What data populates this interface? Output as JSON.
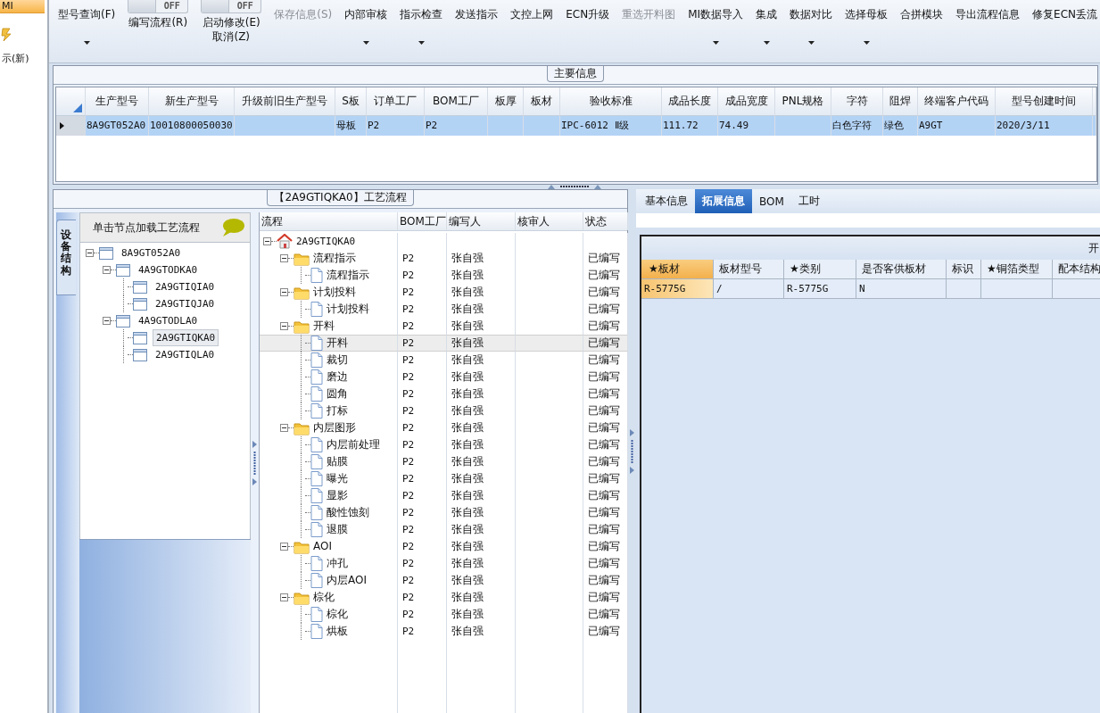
{
  "sidebar": {
    "items": [
      {
        "label": "MI",
        "kind": "text",
        "selected": true
      },
      {
        "kind": "icon",
        "selected": false
      },
      {
        "label": "示(新)",
        "kind": "text",
        "selected": false
      }
    ]
  },
  "ribbon": {
    "buttons": [
      {
        "kind": "button",
        "label": "型号查询(F)",
        "dropdown": true,
        "disabled": false
      },
      {
        "kind": "toggle",
        "toggle_text": "OFF",
        "on": false,
        "label": "编写流程(R)"
      },
      {
        "kind": "toggle",
        "toggle_text": "OFF",
        "on": false,
        "label": "启动修改(E)",
        "sublabel": "取消(Z)"
      },
      {
        "kind": "button",
        "label": "保存信息(S)",
        "dropdown": false,
        "disabled": true
      },
      {
        "kind": "button",
        "label": "内部审核",
        "dropdown": true,
        "disabled": false
      },
      {
        "kind": "button",
        "label": "指示检查",
        "dropdown": true,
        "disabled": false
      },
      {
        "kind": "button",
        "label": "发送指示",
        "dropdown": false,
        "disabled": false
      },
      {
        "kind": "button",
        "label": "文控上网",
        "dropdown": false,
        "disabled": false
      },
      {
        "kind": "button",
        "label": "ECN升级",
        "dropdown": false,
        "disabled": false
      },
      {
        "kind": "button",
        "label": "重选开料图",
        "dropdown": false,
        "disabled": true
      },
      {
        "kind": "button",
        "label": "MI数据导入",
        "dropdown": true,
        "disabled": false
      },
      {
        "kind": "button",
        "label": "集成",
        "dropdown": true,
        "disabled": false
      },
      {
        "kind": "button",
        "label": "数据对比",
        "dropdown": true,
        "disabled": false
      },
      {
        "kind": "button",
        "label": "选择母板",
        "dropdown": true,
        "disabled": false
      },
      {
        "kind": "button",
        "label": "合拼模块",
        "dropdown": false,
        "disabled": false
      },
      {
        "kind": "button",
        "label": "导出流程信息",
        "dropdown": false,
        "disabled": false
      },
      {
        "kind": "button",
        "label": "修复ECN丢流",
        "dropdown": false,
        "disabled": false
      }
    ]
  },
  "main_info": {
    "title": "主要信息",
    "table": {
      "columns": [
        "生产型号",
        "新生产型号",
        "升级前旧生产型号",
        "S板",
        "订单工厂",
        "BOM工厂",
        "板厚",
        "板材",
        "验收标准",
        "成品长度",
        "成品宽度",
        "PNL规格",
        "字符",
        "阻焊",
        "终端客户代码",
        "型号创建时间"
      ],
      "rows": [
        {
          "selected": true,
          "cells": [
            "8A9GT052A0",
            "10010800050030",
            "",
            "母板",
            "P2",
            "P2",
            "",
            "",
            "IPC-6012 Ⅱ级",
            "111.72",
            "74.49",
            "",
            "白色字符",
            "绿色",
            "A9GT",
            "2020/3/11"
          ]
        }
      ]
    }
  },
  "process_panel": {
    "title": "【2A9GTIQKA0】工艺流程",
    "side_tab": "设备结构",
    "tree_header": "单击节点加载工艺流程",
    "tree": [
      {
        "label": "8A9GT052A0",
        "expanded": true,
        "selected": false,
        "children": [
          {
            "label": "4A9GTODKA0",
            "expanded": true,
            "selected": false,
            "children": [
              {
                "label": "2A9GTIQIA0",
                "selected": false
              },
              {
                "label": "2A9GTIQJA0",
                "selected": false
              }
            ]
          },
          {
            "label": "4A9GTODLA0",
            "expanded": true,
            "selected": false,
            "children": [
              {
                "label": "2A9GTIQKA0",
                "selected": true
              },
              {
                "label": "2A9GTIQLA0",
                "selected": false
              }
            ]
          }
        ]
      }
    ],
    "grid": {
      "columns": [
        "流程",
        "BOM工厂",
        "编写人",
        "核审人",
        "状态"
      ],
      "rows": [
        {
          "kind": "root",
          "label": "2A9GTIQKA0",
          "expanded": true,
          "selected": false,
          "children": [
            {
              "kind": "folder",
              "label": "流程指示",
              "bom": "P2",
              "writer": "张自强",
              "status": "已编写",
              "expanded": true,
              "selected": false,
              "children": [
                {
                  "kind": "step",
                  "label": "流程指示",
                  "bom": "P2",
                  "writer": "张自强",
                  "status": "已编写",
                  "selected": false
                }
              ]
            },
            {
              "kind": "folder",
              "label": "计划投料",
              "bom": "P2",
              "writer": "张自强",
              "status": "已编写",
              "expanded": true,
              "selected": false,
              "children": [
                {
                  "kind": "step",
                  "label": "计划投料",
                  "bom": "P2",
                  "writer": "张自强",
                  "status": "已编写",
                  "selected": false
                }
              ]
            },
            {
              "kind": "folder",
              "label": "开料",
              "bom": "P2",
              "writer": "张自强",
              "status": "已编写",
              "expanded": true,
              "selected": false,
              "children": [
                {
                  "kind": "step",
                  "label": "开料",
                  "bom": "P2",
                  "writer": "张自强",
                  "status": "已编写",
                  "selected": true
                },
                {
                  "kind": "step",
                  "label": "裁切",
                  "bom": "P2",
                  "writer": "张自强",
                  "status": "已编写",
                  "selected": false
                },
                {
                  "kind": "step",
                  "label": "磨边",
                  "bom": "P2",
                  "writer": "张自强",
                  "status": "已编写",
                  "selected": false
                },
                {
                  "kind": "step",
                  "label": "圆角",
                  "bom": "P2",
                  "writer": "张自强",
                  "status": "已编写",
                  "selected": false
                },
                {
                  "kind": "step",
                  "label": "打标",
                  "bom": "P2",
                  "writer": "张自强",
                  "status": "已编写",
                  "selected": false
                }
              ]
            },
            {
              "kind": "folder",
              "label": "内层图形",
              "bom": "P2",
              "writer": "张自强",
              "status": "已编写",
              "expanded": true,
              "selected": false,
              "children": [
                {
                  "kind": "step",
                  "label": "内层前处理",
                  "bom": "P2",
                  "writer": "张自强",
                  "status": "已编写",
                  "selected": false
                },
                {
                  "kind": "step",
                  "label": "贴膜",
                  "bom": "P2",
                  "writer": "张自强",
                  "status": "已编写",
                  "selected": false
                },
                {
                  "kind": "step",
                  "label": "曝光",
                  "bom": "P2",
                  "writer": "张自强",
                  "status": "已编写",
                  "selected": false
                },
                {
                  "kind": "step",
                  "label": "显影",
                  "bom": "P2",
                  "writer": "张自强",
                  "status": "已编写",
                  "selected": false
                },
                {
                  "kind": "step",
                  "label": "酸性蚀刻",
                  "bom": "P2",
                  "writer": "张自强",
                  "status": "已编写",
                  "selected": false
                },
                {
                  "kind": "step",
                  "label": "退膜",
                  "bom": "P2",
                  "writer": "张自强",
                  "status": "已编写",
                  "selected": false
                }
              ]
            },
            {
              "kind": "folder",
              "label": "AOI",
              "bom": "P2",
              "writer": "张自强",
              "status": "已编写",
              "expanded": true,
              "selected": false,
              "children": [
                {
                  "kind": "step",
                  "label": "冲孔",
                  "bom": "P2",
                  "writer": "张自强",
                  "status": "已编写",
                  "selected": false
                },
                {
                  "kind": "step",
                  "label": "内层AOI",
                  "bom": "P2",
                  "writer": "张自强",
                  "status": "已编写",
                  "selected": false
                }
              ]
            },
            {
              "kind": "folder",
              "label": "棕化",
              "bom": "P2",
              "writer": "张自强",
              "status": "已编写",
              "expanded": true,
              "selected": false,
              "children": [
                {
                  "kind": "step",
                  "label": "棕化",
                  "bom": "P2",
                  "writer": "张自强",
                  "status": "已编写",
                  "selected": false
                },
                {
                  "kind": "step",
                  "label": "烘板",
                  "bom": "P2",
                  "writer": "张自强",
                  "status": "已编写",
                  "selected": false
                }
              ]
            }
          ]
        }
      ]
    }
  },
  "detail_panel": {
    "tabs": [
      {
        "label": "基本信息",
        "selected": false
      },
      {
        "label": "拓展信息",
        "selected": true
      },
      {
        "label": "BOM",
        "selected": false
      },
      {
        "label": "工时",
        "selected": false
      }
    ],
    "section_title": "开",
    "table": {
      "columns": [
        {
          "label": "★板材",
          "selected": true
        },
        {
          "label": "板材型号",
          "selected": false
        },
        {
          "label": "★类别",
          "selected": false
        },
        {
          "label": "是否客供板材",
          "selected": false
        },
        {
          "label": "标识",
          "selected": false
        },
        {
          "label": "★铜箔类型",
          "selected": false
        },
        {
          "label": "配本结构",
          "selected": false
        }
      ],
      "rows": [
        {
          "cells": [
            "R-5775G",
            "/",
            "R-5775G",
            "N",
            "",
            "",
            ""
          ]
        }
      ]
    }
  }
}
